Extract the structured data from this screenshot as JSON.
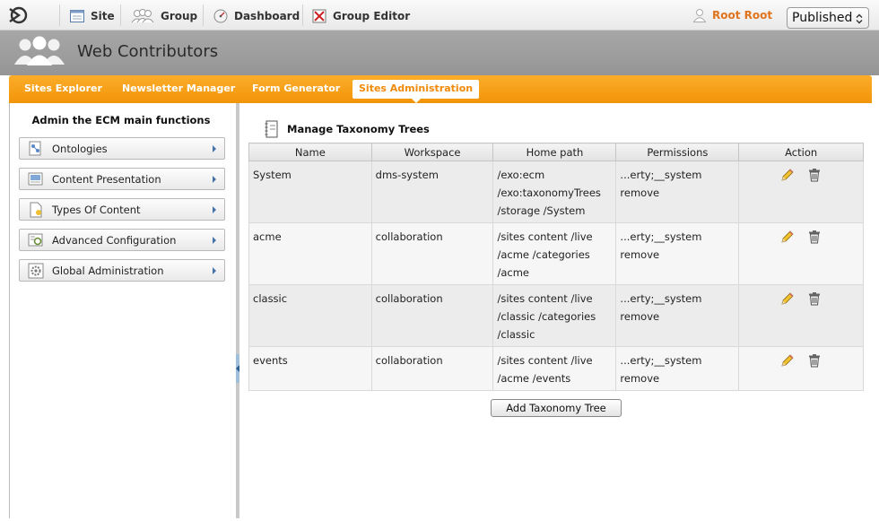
{
  "topbar": {
    "nav": [
      {
        "label": "Site",
        "icon": "site-icon"
      },
      {
        "label": "Group",
        "icon": "group-icon"
      },
      {
        "label": "Dashboard",
        "icon": "dashboard-icon"
      },
      {
        "label": "Group Editor",
        "icon": "group-editor-icon"
      }
    ],
    "user": "Root Root",
    "mode_select": "Published"
  },
  "header": {
    "title": "Web Contributors"
  },
  "tabs": [
    {
      "label": "Sites Explorer"
    },
    {
      "label": "Newsletter Manager"
    },
    {
      "label": "Form Generator"
    },
    {
      "label": "Sites Administration",
      "active": true
    }
  ],
  "left_panel": {
    "title": "Admin the ECM main functions",
    "items": [
      {
        "label": "Ontologies",
        "icon": "ontologies-icon"
      },
      {
        "label": "Content Presentation",
        "icon": "content-presentation-icon"
      },
      {
        "label": "Types Of Content",
        "icon": "types-of-content-icon"
      },
      {
        "label": "Advanced Configuration",
        "icon": "advanced-configuration-icon"
      },
      {
        "label": "Global Administration",
        "icon": "global-administration-icon"
      }
    ]
  },
  "main": {
    "title": "Manage Taxonomy Trees",
    "columns": [
      "Name",
      "Workspace",
      "Home path",
      "Permissions",
      "Action"
    ],
    "rows": [
      {
        "name": "System",
        "workspace": "dms-system",
        "path": [
          "/exo:ecm",
          "/exo:taxonomyTrees",
          "/storage /System"
        ],
        "perm": [
          "...erty;__system",
          "remove"
        ]
      },
      {
        "name": "acme",
        "workspace": "collaboration",
        "path": [
          "/sites content /live",
          "/acme /categories",
          "/acme"
        ],
        "perm": [
          "...erty;__system",
          "remove"
        ]
      },
      {
        "name": "classic",
        "workspace": "collaboration",
        "path": [
          "/sites content /live",
          "/classic /categories",
          "/classic"
        ],
        "perm": [
          "...erty;__system",
          "remove"
        ]
      },
      {
        "name": "events",
        "workspace": "collaboration",
        "path": [
          "/sites content /live",
          "/acme /events"
        ],
        "perm": [
          "...erty;__system",
          "remove"
        ]
      }
    ],
    "add_button": "Add Taxonomy Tree"
  },
  "colors": {
    "accent": "#f79c0d",
    "user": "#e0741c",
    "header": "#9e9e9e"
  }
}
